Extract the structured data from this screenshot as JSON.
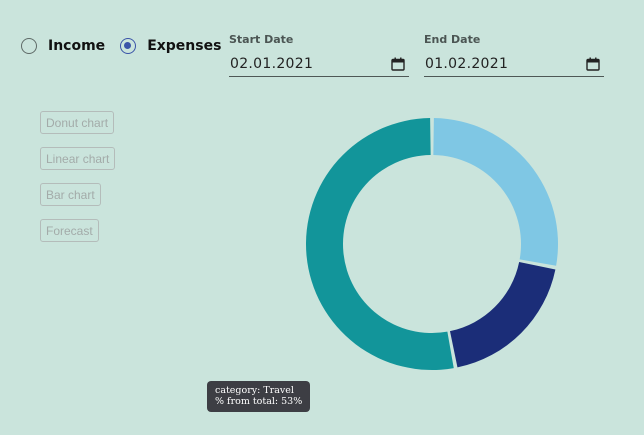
{
  "type_selector": {
    "options": [
      {
        "label": "Income",
        "selected": false
      },
      {
        "label": "Expenses",
        "selected": true
      }
    ]
  },
  "start_date": {
    "label": "Start Date",
    "value": "02.01.2021",
    "icon": "calendar-icon"
  },
  "end_date": {
    "label": "End Date",
    "value": "01.02.2021",
    "icon": "calendar-icon"
  },
  "chart_buttons": [
    {
      "label": "Donut chart"
    },
    {
      "label": "Linear chart"
    },
    {
      "label": "Bar chart"
    },
    {
      "label": "Forecast"
    }
  ],
  "colors": {
    "background": "#cae4dc",
    "radio_selected": "#3a54a8",
    "segment_light_blue": "#7fc7e4",
    "segment_navy": "#1b2d78",
    "segment_teal": "#12959a",
    "tooltip_bg": "#3d3e44"
  },
  "chart_data": {
    "type": "pie",
    "donut": true,
    "title": "",
    "slices": [
      {
        "value": 28,
        "color": "#7fc7e4"
      },
      {
        "value": 19,
        "color": "#1b2d78"
      },
      {
        "value": 53,
        "color": "#12959a"
      }
    ]
  },
  "tooltip": {
    "line1": "category: Travel",
    "line2": "% from total: 53%"
  }
}
